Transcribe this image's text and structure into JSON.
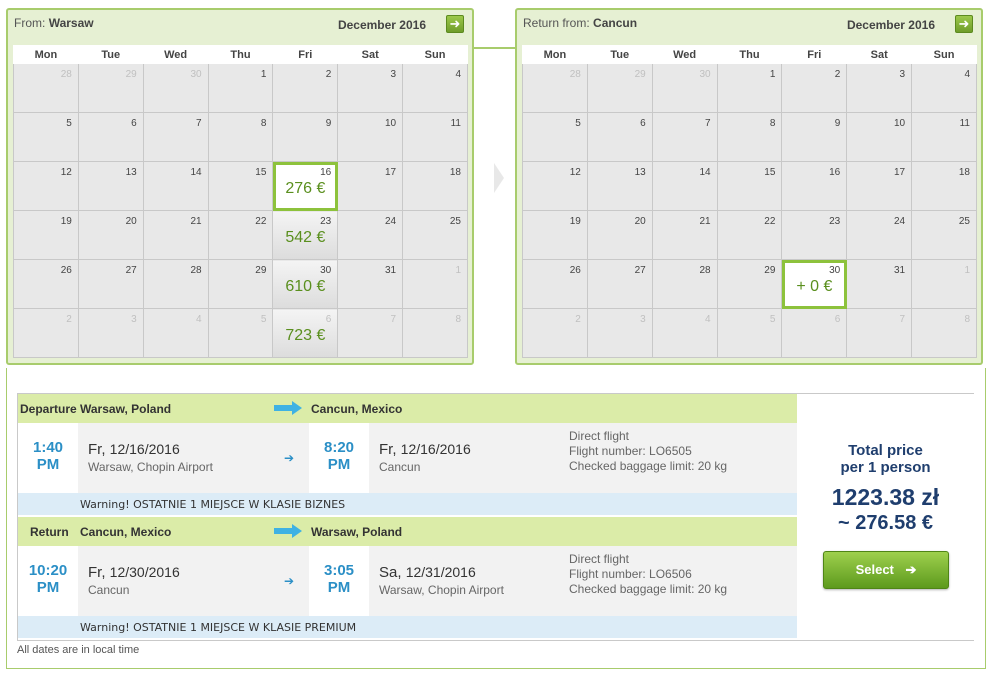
{
  "outbound_calendar": {
    "title_prefix": "From:",
    "city": "Warsaw",
    "month": "December 2016",
    "next_icon": "arrow-right-icon",
    "weekdays": [
      "Mon",
      "Tue",
      "Wed",
      "Thu",
      "Fri",
      "Sat",
      "Sun"
    ],
    "weeks": [
      [
        {
          "d": "28",
          "o": true
        },
        {
          "d": "29",
          "o": true
        },
        {
          "d": "30",
          "o": true
        },
        {
          "d": "1"
        },
        {
          "d": "2"
        },
        {
          "d": "3"
        },
        {
          "d": "4"
        }
      ],
      [
        {
          "d": "5"
        },
        {
          "d": "6"
        },
        {
          "d": "7"
        },
        {
          "d": "8"
        },
        {
          "d": "9"
        },
        {
          "d": "10"
        },
        {
          "d": "11"
        }
      ],
      [
        {
          "d": "12"
        },
        {
          "d": "13"
        },
        {
          "d": "14"
        },
        {
          "d": "15"
        },
        {
          "d": "16",
          "p": "276 €",
          "sel": true
        },
        {
          "d": "17"
        },
        {
          "d": "18"
        }
      ],
      [
        {
          "d": "19"
        },
        {
          "d": "20"
        },
        {
          "d": "21"
        },
        {
          "d": "22"
        },
        {
          "d": "23",
          "p": "542 €"
        },
        {
          "d": "24"
        },
        {
          "d": "25"
        }
      ],
      [
        {
          "d": "26"
        },
        {
          "d": "27"
        },
        {
          "d": "28"
        },
        {
          "d": "29"
        },
        {
          "d": "30",
          "p": "610 €"
        },
        {
          "d": "31"
        },
        {
          "d": "1",
          "o": true
        }
      ],
      [
        {
          "d": "2",
          "o": true
        },
        {
          "d": "3",
          "o": true
        },
        {
          "d": "4",
          "o": true
        },
        {
          "d": "5",
          "o": true
        },
        {
          "d": "6",
          "o": true,
          "p": "723 €"
        },
        {
          "d": "7",
          "o": true
        },
        {
          "d": "8",
          "o": true
        }
      ]
    ]
  },
  "return_calendar": {
    "title_prefix": "Return from:",
    "city": "Cancun",
    "month": "December 2016",
    "next_icon": "arrow-right-icon",
    "weekdays": [
      "Mon",
      "Tue",
      "Wed",
      "Thu",
      "Fri",
      "Sat",
      "Sun"
    ],
    "weeks": [
      [
        {
          "d": "28",
          "o": true
        },
        {
          "d": "29",
          "o": true
        },
        {
          "d": "30",
          "o": true
        },
        {
          "d": "1"
        },
        {
          "d": "2"
        },
        {
          "d": "3"
        },
        {
          "d": "4"
        }
      ],
      [
        {
          "d": "5"
        },
        {
          "d": "6"
        },
        {
          "d": "7"
        },
        {
          "d": "8"
        },
        {
          "d": "9"
        },
        {
          "d": "10"
        },
        {
          "d": "11"
        }
      ],
      [
        {
          "d": "12"
        },
        {
          "d": "13"
        },
        {
          "d": "14"
        },
        {
          "d": "15"
        },
        {
          "d": "16"
        },
        {
          "d": "17"
        },
        {
          "d": "18"
        }
      ],
      [
        {
          "d": "19"
        },
        {
          "d": "20"
        },
        {
          "d": "21"
        },
        {
          "d": "22"
        },
        {
          "d": "23"
        },
        {
          "d": "24"
        },
        {
          "d": "25"
        }
      ],
      [
        {
          "d": "26"
        },
        {
          "d": "27"
        },
        {
          "d": "28"
        },
        {
          "d": "29"
        },
        {
          "d": "30",
          "p": "+ 0 €",
          "sel": true
        },
        {
          "d": "31"
        },
        {
          "d": "1",
          "o": true
        }
      ],
      [
        {
          "d": "2",
          "o": true
        },
        {
          "d": "3",
          "o": true
        },
        {
          "d": "4",
          "o": true
        },
        {
          "d": "5",
          "o": true
        },
        {
          "d": "6",
          "o": true
        },
        {
          "d": "7",
          "o": true
        },
        {
          "d": "8",
          "o": true
        }
      ]
    ]
  },
  "departure": {
    "label": "Departure",
    "from": "Warsaw, Poland",
    "to": "Cancun, Mexico",
    "dep_time": "1:40",
    "dep_ampm": "PM",
    "dep_day": "Fr,",
    "dep_date": "12/16/2016",
    "dep_airport": "Warsaw, Chopin Airport",
    "arr_time": "8:20",
    "arr_ampm": "PM",
    "arr_day": "Fr,",
    "arr_date": "12/16/2016",
    "arr_airport": "Cancun",
    "info_direct": "Direct flight",
    "info_flight": "Flight number: LO6505",
    "info_baggage": "Checked baggage limit: 20 kg",
    "warning": "Warning! OSTATNIE 1 MIEJSCE W KLASIE BIZNES"
  },
  "return": {
    "label": "Return",
    "from": "Cancun, Mexico",
    "to": "Warsaw, Poland",
    "dep_time": "10:20",
    "dep_ampm": "PM",
    "dep_day": "Fr,",
    "dep_date": "12/30/2016",
    "dep_airport": "Cancun",
    "arr_time": "3:05",
    "arr_ampm": "PM",
    "arr_day": "Sa,",
    "arr_date": "12/31/2016",
    "arr_airport": "Warsaw, Chopin Airport",
    "info_direct": "Direct flight",
    "info_flight": "Flight number: LO6506",
    "info_baggage": "Checked baggage limit: 20 kg",
    "warning": "Warning! OSTATNIE 1 MIEJSCE W KLASIE PREMIUM"
  },
  "total": {
    "label_line1": "Total price",
    "label_line2": "per 1 person",
    "price_pln": "1223.38 zł",
    "price_eur": "~ 276.58 €",
    "select_label": "Select",
    "select_icon": "arrow-right-icon"
  },
  "footer_note": "All dates are in local time",
  "colors": {
    "accent_green": "#8dc23c",
    "price_green": "#5a8f1e",
    "time_blue": "#2b8fc6",
    "total_navy": "#1f3e6e",
    "route_bar": "#dbeca8",
    "warning_bg": "#dcecf7"
  }
}
